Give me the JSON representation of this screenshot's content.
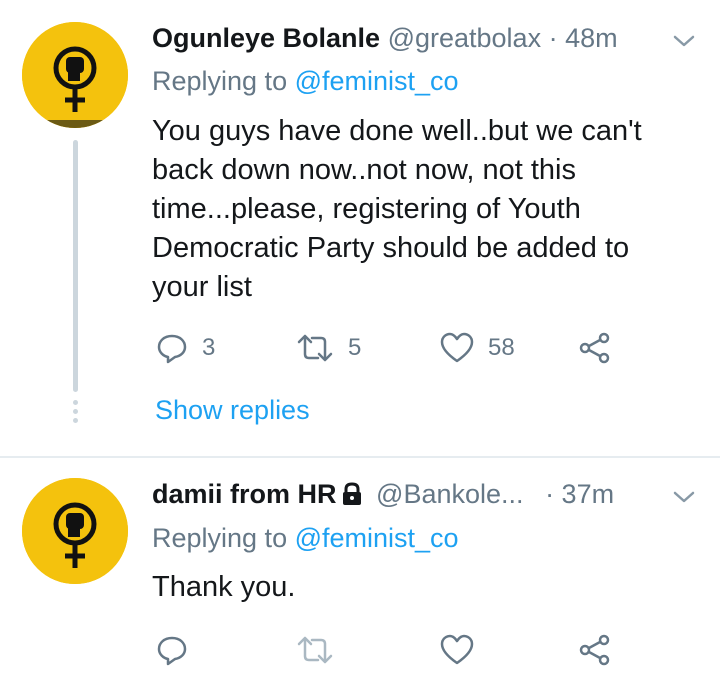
{
  "colors": {
    "accent": "#1da1f2",
    "secondary_text": "#657786",
    "primary_text": "#14171a",
    "avatar_bg": "#f4c20d",
    "divider": "#e6ecf0"
  },
  "tweets": [
    {
      "display_name": "Ogunleye Bolanle",
      "handle": "@greatbolax",
      "time": "· 48m",
      "replying_prefix": "Replying to",
      "replying_to": "@feminist_co",
      "text": "You guys have done well..but we can't back down now..not now, not this time...please, registering of Youth Democratic Party should be added to your list",
      "reply_count": "3",
      "retweet_count": "5",
      "like_count": "58",
      "show_replies": "Show replies",
      "icons": [
        "feminist-fist-avatar",
        "chevron-down-icon",
        "reply-icon",
        "retweet-icon",
        "heart-icon",
        "share-icon"
      ]
    },
    {
      "display_name": "damii from HR",
      "handle": "@Bankole...",
      "time": "· 37m",
      "replying_prefix": "Replying to",
      "replying_to": "@feminist_co",
      "text": "Thank you.",
      "icons": [
        "feminist-fist-avatar",
        "lock-icon",
        "chevron-down-icon",
        "reply-icon",
        "retweet-icon",
        "heart-icon",
        "share-icon"
      ]
    }
  ]
}
